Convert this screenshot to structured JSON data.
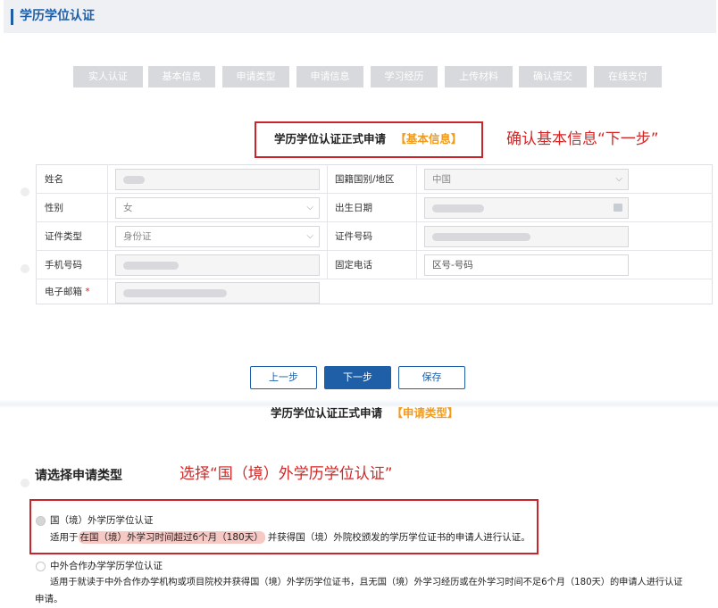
{
  "header": {
    "title": "学历学位认证"
  },
  "steps": [
    "实人认证",
    "基本信息",
    "申请类型",
    "申请信息",
    "学习经历",
    "上传材料",
    "确认提交",
    "在线支付"
  ],
  "form": {
    "title": "学历学位认证正式申请",
    "title_tag": "【基本信息】",
    "annotation": "确认基本信息“下一步”",
    "fields": {
      "name_label": "姓名",
      "nationality_label": "国籍国别/地区",
      "nationality_value": "中国",
      "gender_label": "性别",
      "gender_value": "女",
      "birth_label": "出生日期",
      "id_type_label": "证件类型",
      "id_type_value": "身份证",
      "id_no_label": "证件号码",
      "mobile_label": "手机号码",
      "phone_label": "固定电话",
      "phone_placeholder": "区号-号码",
      "email_label": "电子邮箱",
      "required_mark": "*"
    }
  },
  "buttons": {
    "prev": "上一步",
    "next": "下一步",
    "save": "保存"
  },
  "section2": {
    "title": "学历学位认证正式申请",
    "title_tag": "【申请类型】",
    "choose_label": "请选择申请类型",
    "annotation": "选择“国（境）外学历学位认证”",
    "options": [
      {
        "label": "国（境）外学历学位认证",
        "desc_prefix": "适用于",
        "desc_highlight": "在国（境）外学习时间超过6个月（180天）",
        "desc_suffix": "并获得国（境）外院校颁发的学历学位证书的申请人进行认证。"
      },
      {
        "label": "中外合作办学学历学位认证",
        "desc_line1": "适用于就读于中外合作办学机构或项目院校并获得国（境）外学历学位证书，且无国（境）外学习经历或在外学习时间不足6个月（180天）的申请人进行认证",
        "desc_line2": "申请。"
      }
    ]
  },
  "colors": {
    "primary": "#1e5fa8",
    "accent": "#f19b1c",
    "annotation": "#d32626"
  }
}
